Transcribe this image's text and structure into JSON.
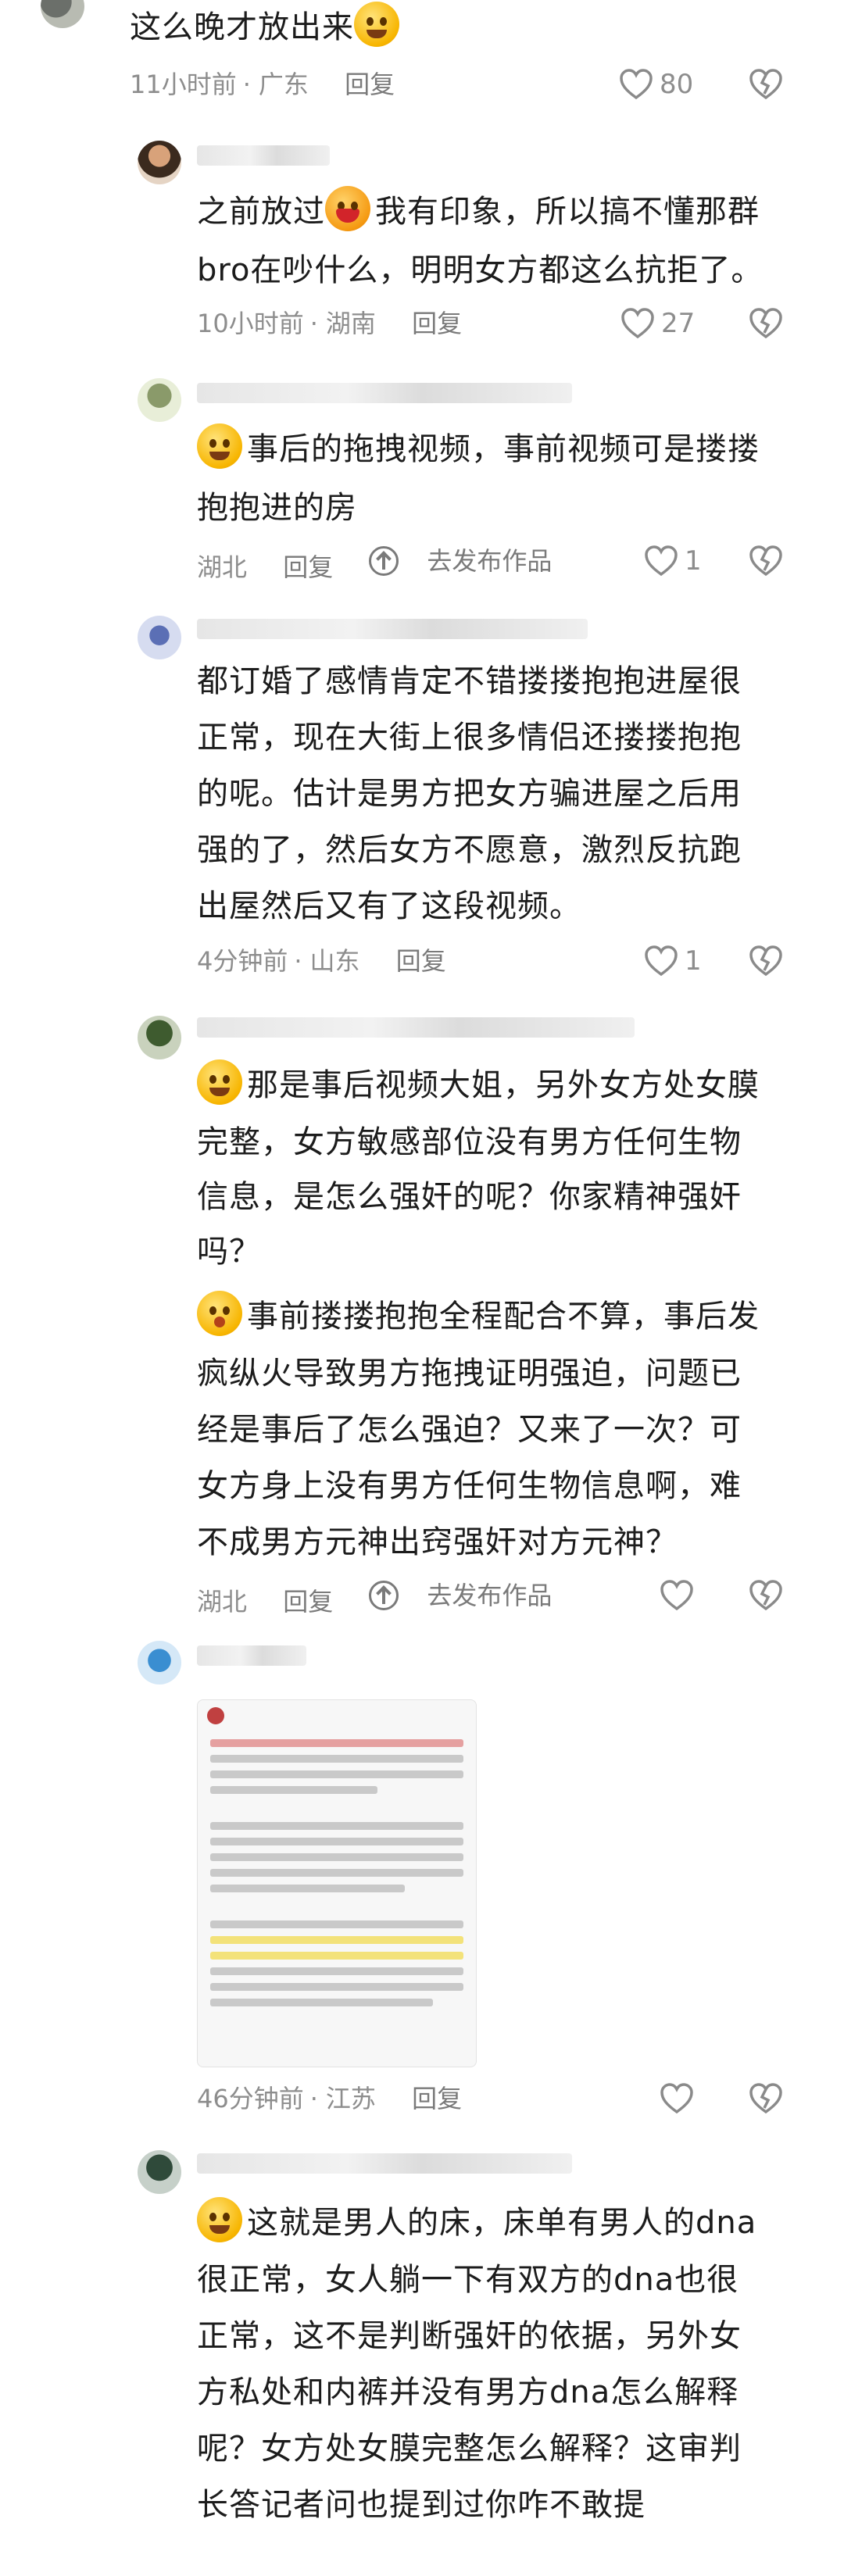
{
  "comments": [
    {
      "text": "这么晚才放出来",
      "emoji": "sweat-smile",
      "time": "11小时前",
      "location": "广东",
      "reply": "回复",
      "likes": "80"
    },
    {
      "text": "之前放过",
      "emoji": "big-laugh",
      "text2": "我有印象，所以搞不懂那群",
      "text3": "bro在吵什么，明明女方都这么抗拒了。",
      "time": "10小时前",
      "location": "湖南",
      "reply": "回复",
      "likes": "27"
    },
    {
      "emoji": "smile",
      "line1": "事后的拖拽视频，事前视频可是搂搂",
      "line2": "抱抱进的房",
      "location": "湖北",
      "reply": "回复",
      "post_link": "去发布作品",
      "likes": "1"
    },
    {
      "line1": "都订婚了感情肯定不错搂搂抱抱进屋很",
      "line2": "正常，现在大街上很多情侣还搂搂抱抱",
      "line3": "的呢。估计是男方把女方骗进屋之后用",
      "line4": "强的了，然后女方不愿意，激烈反抗跑",
      "line5": "出屋然后又有了这段视频。",
      "time": "4分钟前",
      "location": "山东",
      "reply": "回复",
      "likes": "1"
    },
    {
      "emoji": "smile",
      "line1": "那是事后视频大姐，另外女方处女膜",
      "line2": "完整，女方敏感部位没有男方任何生物",
      "line3": "信息，是怎么强奸的呢？你家精神强奸",
      "line4": "吗？",
      "emoji2": "kiss",
      "line5": "事前搂搂抱抱全程配合不算，事后发",
      "line6": "疯纵火导致男方拖拽证明强迫，问题已",
      "line7": "经是事后了怎么强迫？又来了一次？可",
      "line8": "女方身上没有男方任何生物信息啊，难",
      "line9": "不成男方元神出窍强奸对方元神？",
      "location": "湖北",
      "reply": "回复",
      "post_link": "去发布作品"
    },
    {
      "time": "46分钟前",
      "location": "江苏",
      "reply": "回复"
    },
    {
      "emoji": "smile",
      "line1": "这就是男人的床，床单有男人的dna",
      "line2": "很正常，女人躺一下有双方的dna也很",
      "line3": "正常，这不是判断强奸的依据，另外女",
      "line4": "方私处和内裤并没有男方dna怎么解释",
      "line5": "呢？女方处女膜完整怎么解释？这审判",
      "line6": "长答记者问也提到过你咋不敢提"
    }
  ],
  "icons": {
    "like": "heart-outline-icon",
    "dislike": "broken-heart-icon",
    "post": "upload-circle-icon"
  },
  "colors": {
    "text": "#1c1c1c",
    "meta": "#8d8d8d",
    "background": "#ffffff"
  }
}
